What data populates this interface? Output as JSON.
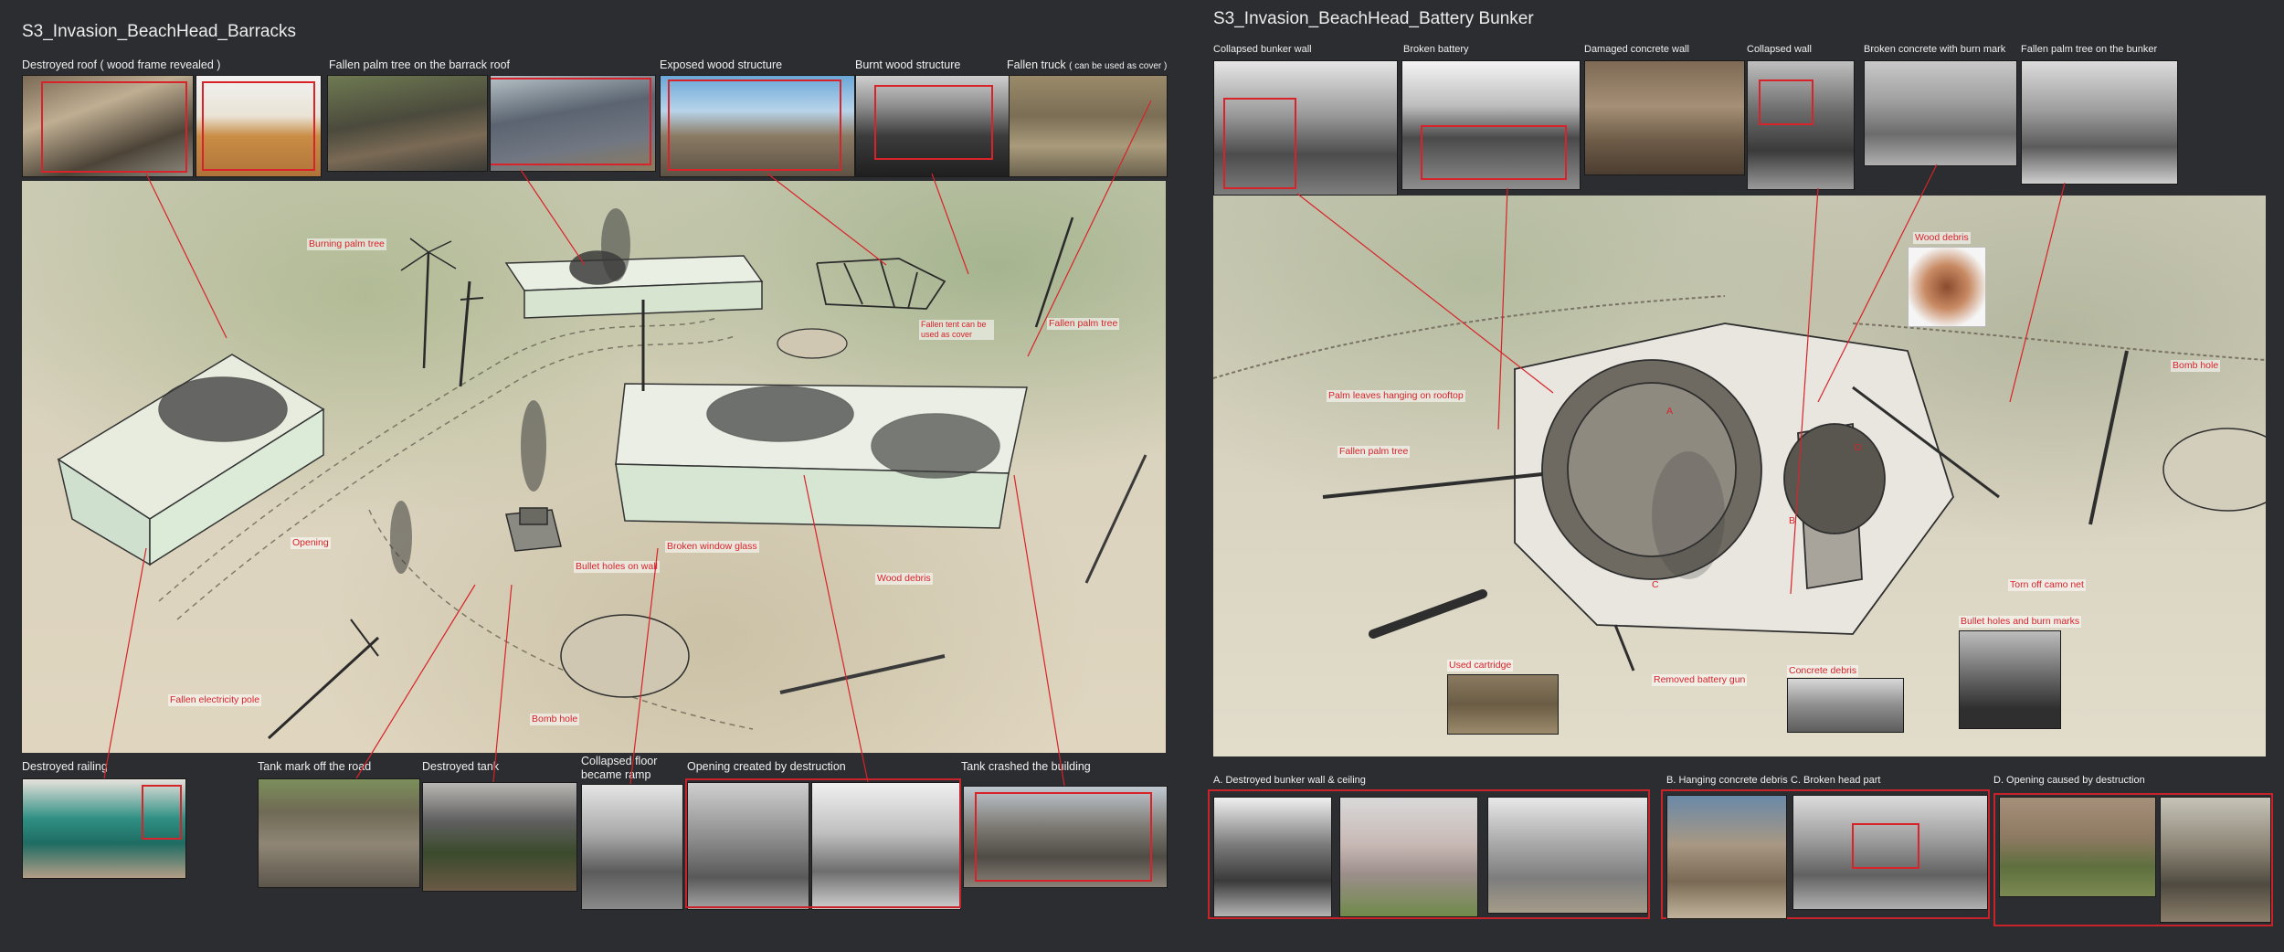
{
  "left_board": {
    "title": "S3_Invasion_BeachHead_Barracks",
    "top_refs": [
      {
        "label": "Destroyed roof ( wood frame revealed )"
      },
      {
        "label": "Fallen palm tree on the barrack roof"
      },
      {
        "label": "Exposed wood structure"
      },
      {
        "label": "Burnt wood structure"
      },
      {
        "label": "Fallen truck",
        "note": "( can be used as cover )"
      }
    ],
    "callouts": {
      "burning_palm": "Burning palm tree",
      "fallen_tent": "Fallen tent can be used as cover",
      "fallen_palm": "Fallen palm tree",
      "opening": "Opening",
      "bullet_holes": "Bullet holes on wall",
      "broken_glass": "Broken window glass",
      "wood_debris": "Wood debris",
      "fallen_pole": "Fallen electricity pole",
      "bomb_hole": "Bomb hole"
    },
    "bottom_refs": [
      {
        "label": "Destroyed railing"
      },
      {
        "label": "Tank mark off the road"
      },
      {
        "label": "Destroyed tank"
      },
      {
        "label": "Collapsed floor became ramp"
      },
      {
        "label": "Opening created by destruction"
      },
      {
        "label": "Tank crashed the building"
      }
    ]
  },
  "right_board": {
    "title": "S3_Invasion_BeachHead_Battery Bunker",
    "top_refs": [
      {
        "label": "Collapsed bunker wall"
      },
      {
        "label": "Broken battery"
      },
      {
        "label": "Damaged concrete wall"
      },
      {
        "label": "Collapsed wall"
      },
      {
        "label": "Broken concrete with burn mark"
      },
      {
        "label": "Fallen palm tree on the bunker"
      }
    ],
    "callouts": {
      "wood_debris": "Wood debris",
      "bomb_hole": "Bomb hole",
      "palm_leaves": "Palm leaves hanging on rooftop",
      "fallen_palm": "Fallen palm tree",
      "torn_camo": "Torn off camo net",
      "bullet_burn": "Bullet holes and burn marks",
      "used_cartridge": "Used cartridge",
      "removed_gun": "Removed battery gun",
      "concrete_debris": "Concrete debris",
      "marker_a": "A",
      "marker_b": "B",
      "marker_c": "C",
      "marker_d": "D"
    },
    "bottom_refs": [
      {
        "label": "A. Destroyed bunker wall & ceiling"
      },
      {
        "label": "B. Hanging concrete debris"
      },
      {
        "label": "C. Broken head part"
      },
      {
        "label": "D. Opening caused by destruction"
      }
    ]
  },
  "colors": {
    "background": "#2b2d30",
    "callout_red": "#d8232a",
    "label_text": "#f0f0f0"
  }
}
